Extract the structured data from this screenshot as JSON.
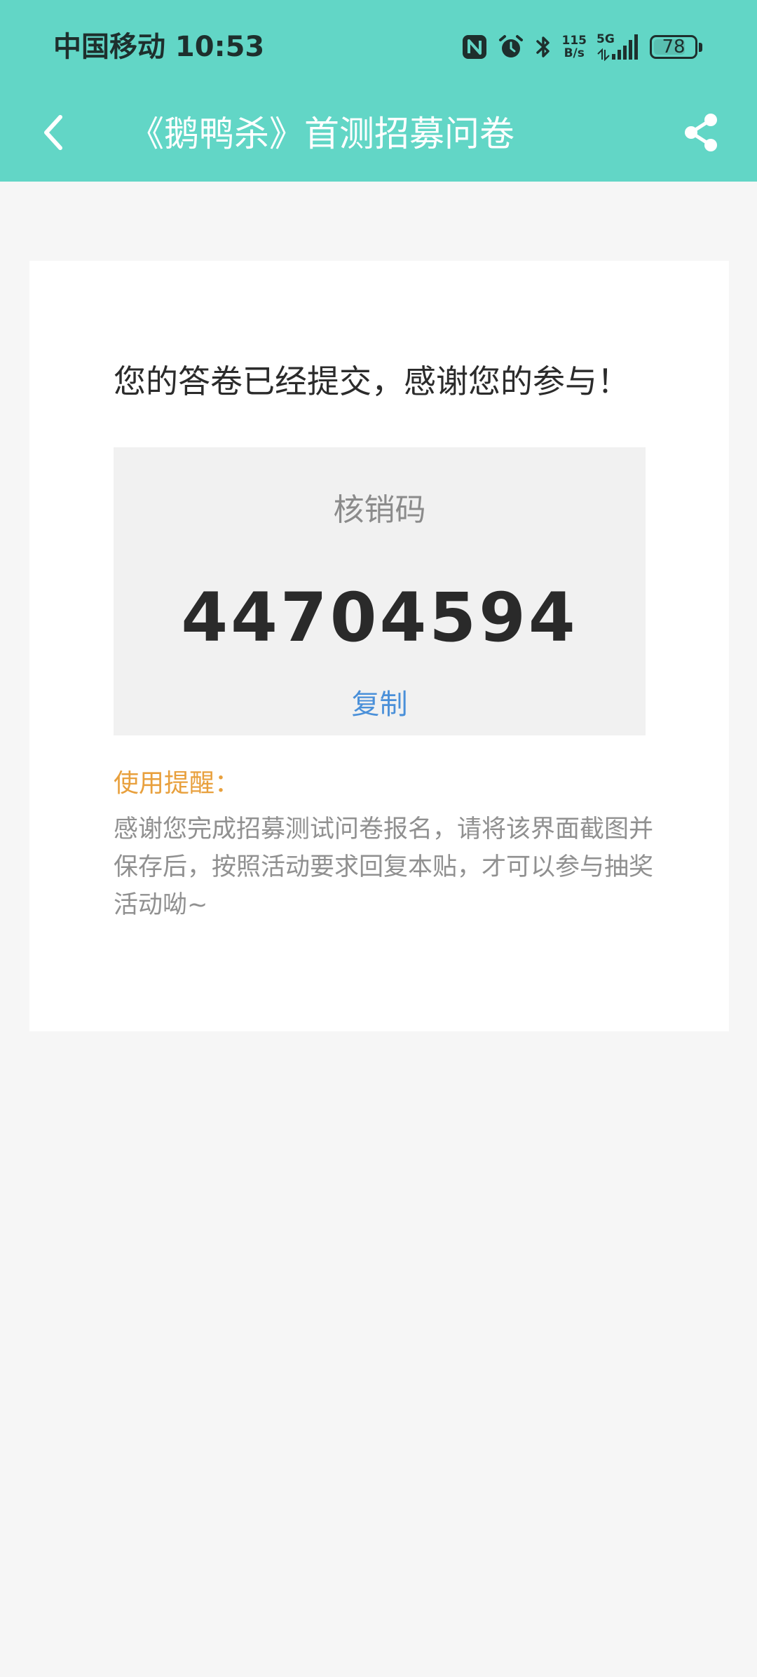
{
  "status_bar": {
    "carrier_time": "中国移动 10:53",
    "net_speed_value": "115",
    "net_speed_unit": "B/s",
    "network_type": "5G",
    "battery_level": "78",
    "battery_fraction": 0.78,
    "icons": [
      "nfc-icon",
      "alarm-icon",
      "bluetooth-icon",
      "signal-icon",
      "battery-icon"
    ]
  },
  "nav": {
    "title": "《鹅鸭杀》首测招募问卷",
    "back_icon": "chevron-left-icon",
    "share_icon": "share-icon"
  },
  "result": {
    "message": "您的答卷已经提交，感谢您的参与！",
    "code_label": "核销码",
    "code_value": "44704594",
    "copy_label": "复制",
    "reminder_title": "使用提醒：",
    "reminder_text": "感谢您完成招募测试问卷报名，请将该界面截图并保存后，按照活动要求回复本贴，才可以参与抽奖活动呦~"
  },
  "colors": {
    "header_bg": "#62d6c6",
    "page_bg": "#f6f6f6",
    "copy_link": "#4a90d9",
    "reminder_title": "#e8a03d"
  }
}
